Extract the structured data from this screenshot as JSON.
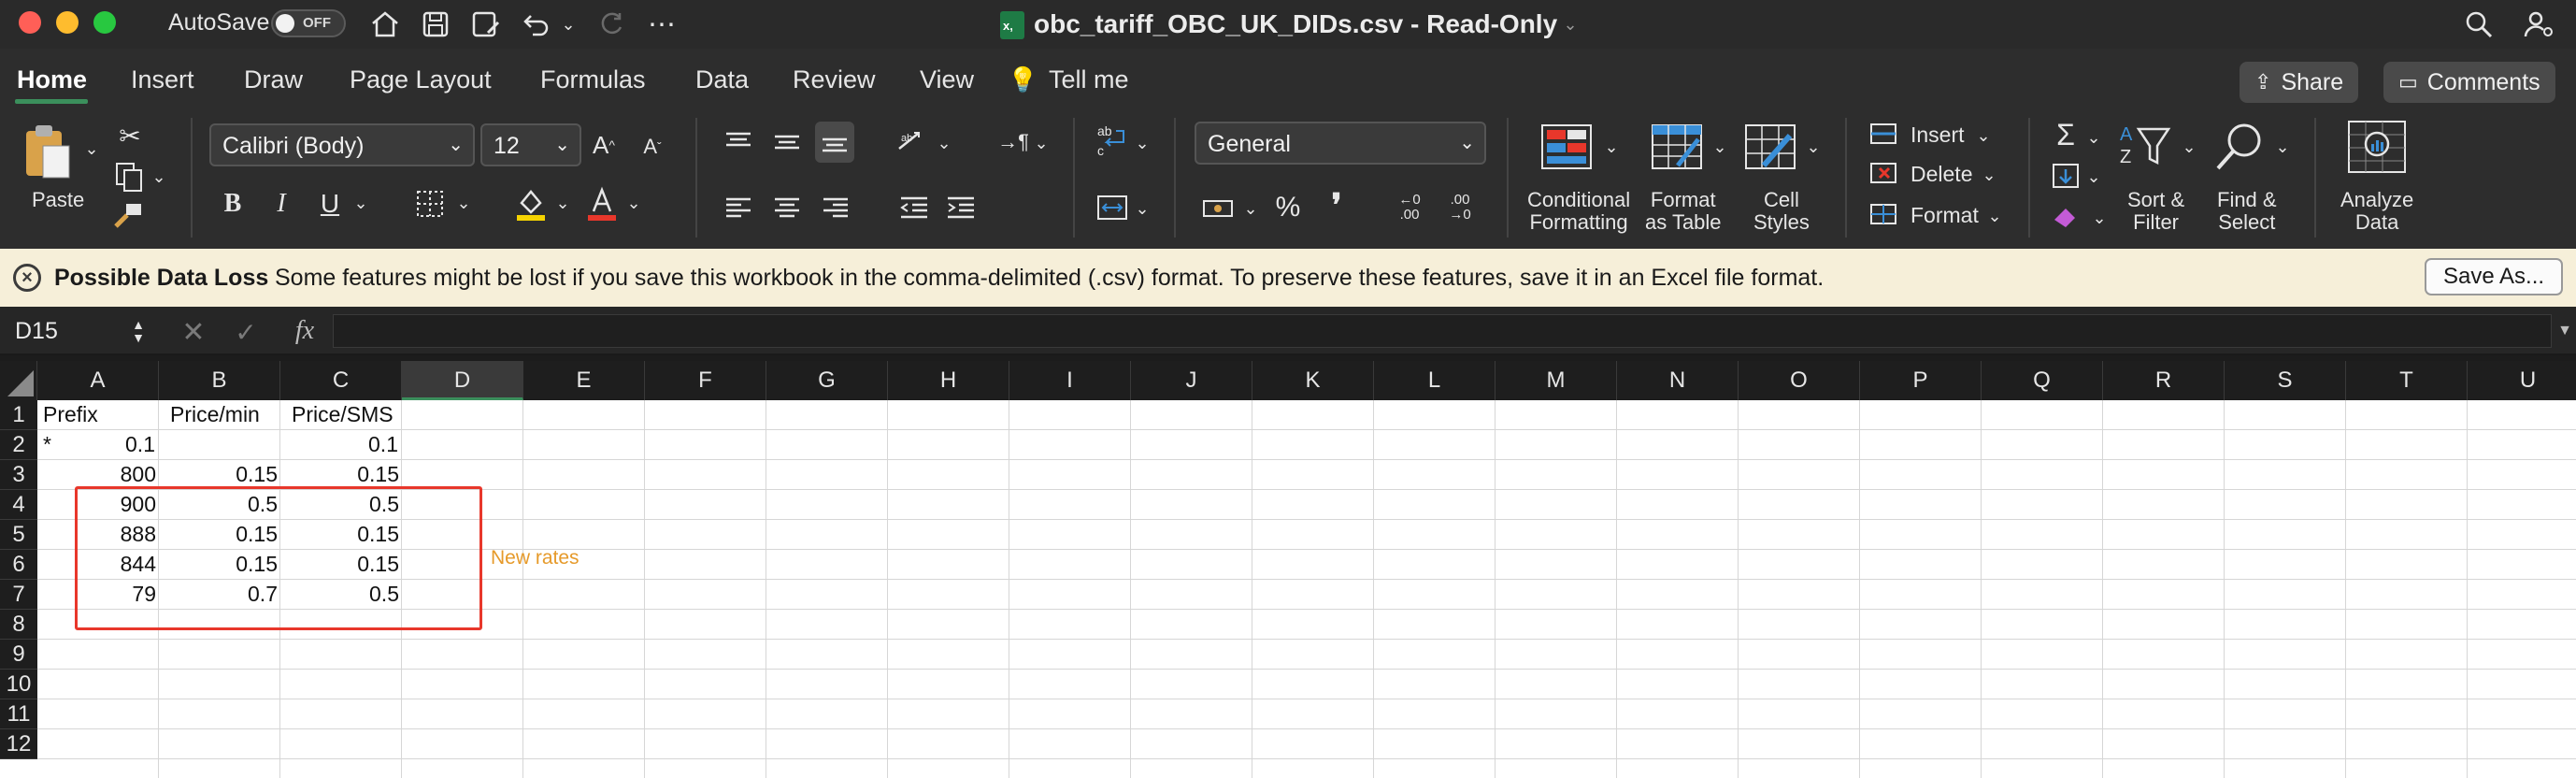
{
  "titlebar": {
    "autosave_label": "AutoSave",
    "autosave_state": "OFF",
    "document_title": "obc_tariff_OBC_UK_DIDs.csv  -  Read-Only",
    "traffic_lights": {
      "close": "#ff5f57",
      "minimize": "#febc2e",
      "zoom": "#28c840"
    }
  },
  "tabs": {
    "items": [
      "Home",
      "Insert",
      "Draw",
      "Page Layout",
      "Formulas",
      "Data",
      "Review",
      "View"
    ],
    "tell_me": "Tell me",
    "share": "Share",
    "comments": "Comments",
    "accent": "#3b8f5c"
  },
  "ribbon": {
    "paste_label": "Paste",
    "font_name": "Calibri (Body)",
    "font_size": "12",
    "number_format": "General",
    "conditional_formatting": [
      "Conditional",
      "Formatting"
    ],
    "format_as_table": [
      "Format",
      "as Table"
    ],
    "cell_styles": [
      "Cell",
      "Styles"
    ],
    "insert_label": "Insert",
    "delete_label": "Delete",
    "format_label": "Format",
    "sort_filter": [
      "Sort &",
      "Filter"
    ],
    "find_select": [
      "Find &",
      "Select"
    ],
    "analyze_data": [
      "Analyze",
      "Data"
    ],
    "highlight_color": "#f5d300",
    "font_color": "#e8372b"
  },
  "message_bar": {
    "title": "Possible Data Loss",
    "text": "Some features might be lost if you save this workbook in the comma-delimited (.csv) format. To preserve these features, save it in an Excel file format.",
    "button": "Save As..."
  },
  "formula_bar": {
    "name_box": "D15",
    "fx": "fx",
    "value": ""
  },
  "sheet": {
    "columns": [
      "A",
      "B",
      "C",
      "D",
      "E",
      "F",
      "G",
      "H",
      "I",
      "J",
      "K",
      "L",
      "M",
      "N",
      "O",
      "P",
      "Q",
      "R",
      "S",
      "T",
      "U"
    ],
    "selected_column": "D",
    "rows": [
      "1",
      "2",
      "3",
      "4",
      "5",
      "6",
      "7",
      "8",
      "9",
      "10",
      "11",
      "12"
    ],
    "headers": [
      "Prefix",
      "Price/min",
      "Price/SMS"
    ],
    "data": [
      [
        "*",
        "0.1",
        "0.1"
      ],
      [
        "800",
        "0.15",
        "0.15"
      ],
      [
        "900",
        "0.5",
        "0.5"
      ],
      [
        "888",
        "0.15",
        "0.15"
      ],
      [
        "844",
        "0.15",
        "0.15"
      ],
      [
        "79",
        "0.7",
        "0.5"
      ]
    ],
    "annotation": "New rates",
    "annotation_color": "#e69a2a",
    "box_color": "#e8372b"
  }
}
